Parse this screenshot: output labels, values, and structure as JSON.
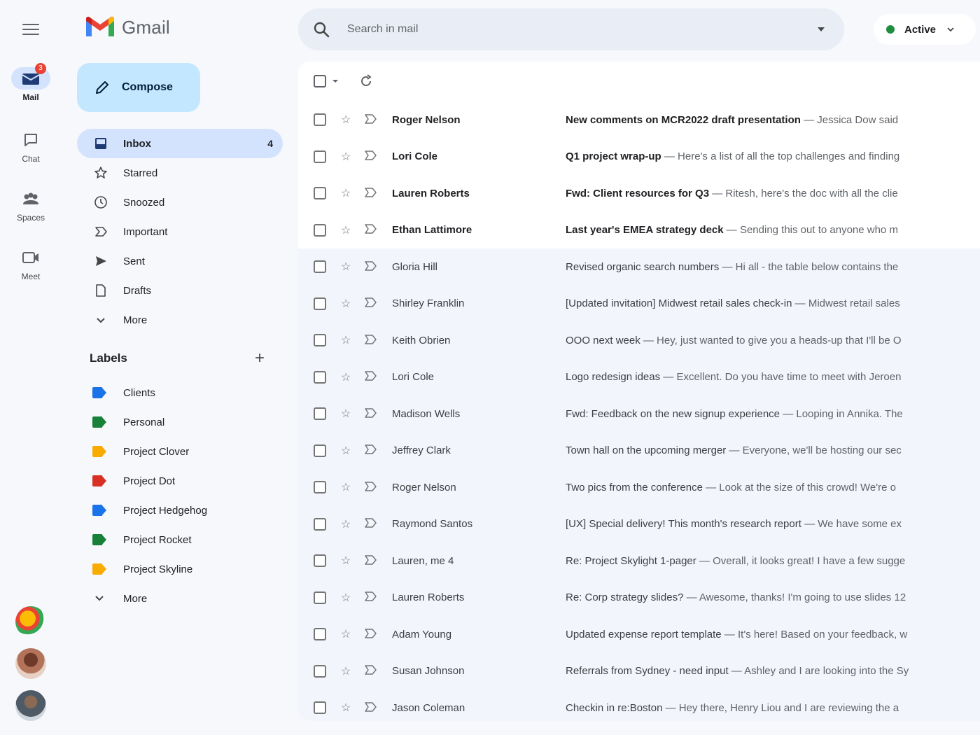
{
  "app": {
    "name": "Gmail"
  },
  "colors": {
    "accent": "#0b57d0",
    "compose_bg": "#c2e7ff",
    "active_bg": "#d3e3fd",
    "status_green": "#1e8e3e"
  },
  "rail": {
    "items": [
      {
        "label": "Mail",
        "icon": "mail-icon",
        "badge": "3",
        "active": true
      },
      {
        "label": "Chat",
        "icon": "chat-icon"
      },
      {
        "label": "Spaces",
        "icon": "spaces-icon"
      },
      {
        "label": "Meet",
        "icon": "meet-icon"
      }
    ]
  },
  "search": {
    "placeholder": "Search in mail"
  },
  "status": {
    "label": "Active"
  },
  "compose": {
    "label": "Compose"
  },
  "nav": {
    "items": [
      {
        "label": "Inbox",
        "icon": "inbox-icon",
        "count": "4",
        "active": true
      },
      {
        "label": "Starred",
        "icon": "star-icon"
      },
      {
        "label": "Snoozed",
        "icon": "clock-icon"
      },
      {
        "label": "Important",
        "icon": "important-icon"
      },
      {
        "label": "Sent",
        "icon": "send-icon"
      },
      {
        "label": "Drafts",
        "icon": "draft-icon"
      },
      {
        "label": "More",
        "icon": "chevron-down-icon"
      }
    ]
  },
  "labels": {
    "title": "Labels",
    "items": [
      {
        "label": "Clients",
        "color": "#1a73e8"
      },
      {
        "label": "Personal",
        "color": "#188038"
      },
      {
        "label": "Project Clover",
        "color": "#f9ab00"
      },
      {
        "label": "Project Dot",
        "color": "#d93025"
      },
      {
        "label": "Project Hedgehog",
        "color": "#1a73e8"
      },
      {
        "label": "Project Rocket",
        "color": "#188038"
      },
      {
        "label": "Project Skyline",
        "color": "#f9ab00"
      }
    ],
    "more": "More"
  },
  "emails": [
    {
      "sender": "Roger Nelson",
      "subject": "New comments on MCR2022 draft presentation",
      "snippet": " — Jessica Dow said",
      "unread": true
    },
    {
      "sender": "Lori Cole",
      "subject": "Q1 project wrap-up",
      "snippet": " — Here's a list of all the top challenges and finding",
      "unread": true
    },
    {
      "sender": "Lauren Roberts",
      "subject": "Fwd: Client resources for Q3",
      "snippet": " — Ritesh, here's the doc with all the clie",
      "unread": true
    },
    {
      "sender": "Ethan Lattimore",
      "subject": "Last year's EMEA strategy deck",
      "snippet": " — Sending this out to anyone who m",
      "unread": true
    },
    {
      "sender": "Gloria Hill",
      "subject": "Revised organic search numbers",
      "snippet": " — Hi all - the table below contains the",
      "unread": false
    },
    {
      "sender": "Shirley Franklin",
      "subject": "[Updated invitation] Midwest retail sales check-in",
      "snippet": " — Midwest retail sales",
      "unread": false
    },
    {
      "sender": "Keith Obrien",
      "subject": "OOO next week",
      "snippet": " — Hey, just wanted to give you a heads-up that I'll be O",
      "unread": false
    },
    {
      "sender": "Lori Cole",
      "subject": "Logo redesign ideas",
      "snippet": " — Excellent. Do you have time to meet with Jeroen",
      "unread": false
    },
    {
      "sender": "Madison Wells",
      "subject": "Fwd: Feedback on the new signup experience",
      "snippet": " — Looping in Annika. The",
      "unread": false
    },
    {
      "sender": "Jeffrey Clark",
      "subject": "Town hall on the upcoming merger",
      "snippet": " — Everyone, we'll be hosting our sec",
      "unread": false
    },
    {
      "sender": "Roger Nelson",
      "subject": "Two pics from the conference",
      "snippet": " — Look at the size of this crowd! We're o",
      "unread": false
    },
    {
      "sender": "Raymond Santos",
      "subject": "[UX] Special delivery! This month's research report",
      "snippet": " — We have some ex",
      "unread": false
    },
    {
      "sender": "Lauren, me 4",
      "subject": "Re: Project Skylight 1-pager",
      "snippet": " — Overall, it looks great! I have a few sugge",
      "unread": false
    },
    {
      "sender": "Lauren Roberts",
      "subject": "Re: Corp strategy slides?",
      "snippet": " — Awesome, thanks! I'm going to use slides 12",
      "unread": false
    },
    {
      "sender": "Adam Young",
      "subject": "Updated expense report template",
      "snippet": " — It's here! Based on your feedback, w",
      "unread": false
    },
    {
      "sender": "Susan Johnson",
      "subject": "Referrals from Sydney - need input",
      "snippet": " — Ashley and I are looking into the Sy",
      "unread": false
    },
    {
      "sender": "Jason Coleman",
      "subject": "Checkin in re:Boston",
      "snippet": " — Hey there, Henry Liou and I are reviewing the a",
      "unread": false
    }
  ]
}
